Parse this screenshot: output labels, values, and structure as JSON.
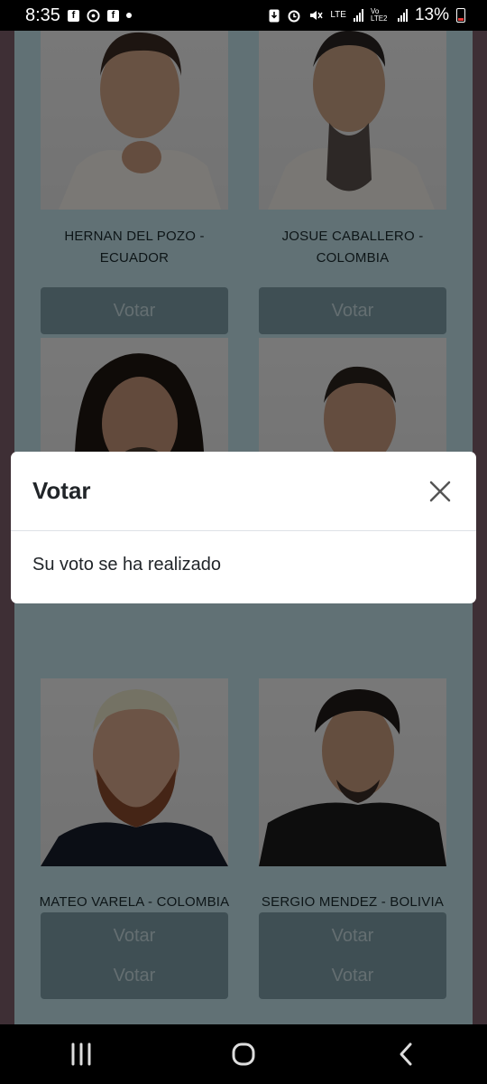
{
  "status_bar": {
    "time": "8:35",
    "battery": "13%",
    "lte_label": "LTE",
    "volte_label": "Vo LTE2",
    "notification_icons": [
      "facebook-icon",
      "messenger-icon",
      "facebook-icon",
      "dot-icon"
    ],
    "system_icons": [
      "download-icon",
      "alarm-icon",
      "mute-icon",
      "lte-icon",
      "signal-icon",
      "signal2-icon",
      "battery-icon"
    ]
  },
  "candidates": [
    {
      "name_line1": "HERNAN DEL POZO -",
      "name_line2": "ECUADOR",
      "vote_label": "Votar"
    },
    {
      "name_line1": "JOSUE CABALLERO -",
      "name_line2": "COLOMBIA",
      "vote_label": "Votar"
    },
    {
      "name_line1": "",
      "name_line2": "",
      "vote_label": "Votar"
    },
    {
      "name_line1": "",
      "name_line2": "",
      "vote_label": "Votar"
    },
    {
      "name_line1": "MATEO VARELA - COLOMBIA",
      "name_line2": "",
      "vote_label": "Votar"
    },
    {
      "name_line1": "SERGIO MENDEZ - BOLIVIA",
      "name_line2": "",
      "vote_label": "Votar"
    }
  ],
  "modal": {
    "title": "Votar",
    "message": "Su voto se ha realizado"
  },
  "colors": {
    "page_bg": "#c3e3ea",
    "button_bg": "#7e9fa9",
    "side_border": "#7d5f6b"
  }
}
